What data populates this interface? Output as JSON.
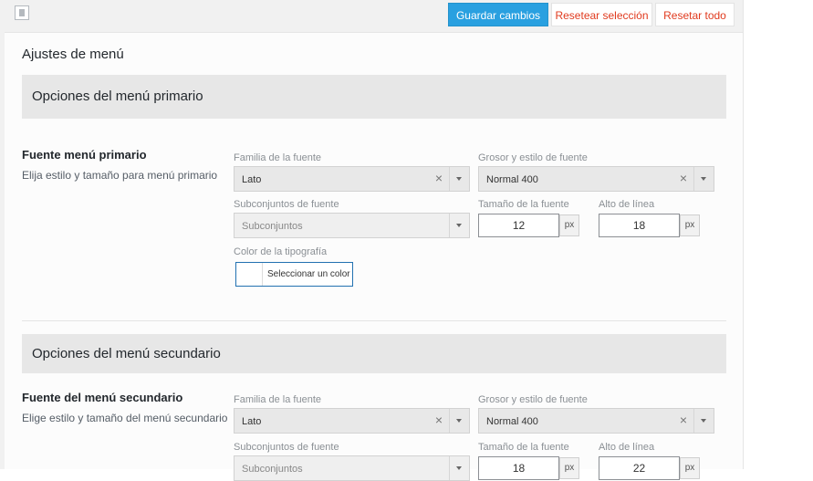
{
  "toolbar": {
    "save_label": "Guardar cambios",
    "reset_selection_label": "Resetear selección",
    "reset_all_label": "Resetar todo"
  },
  "page": {
    "title": "Ajustes de menú"
  },
  "primary": {
    "section_title": "Opciones del menú primario",
    "option_title": "Fuente menú primario",
    "option_desc": "Elija estilo y tamaño para menú primario",
    "font_family": {
      "label": "Familia de la fuente",
      "value": "Lato"
    },
    "font_weight": {
      "label": "Grosor y estilo de fuente",
      "value": "Normal 400"
    },
    "subsets": {
      "label": "Subconjuntos de fuente",
      "placeholder": "Subconjuntos"
    },
    "font_size": {
      "label": "Tamaño de la fuente",
      "value": "12",
      "unit": "px"
    },
    "line_height": {
      "label": "Alto de línea",
      "value": "18",
      "unit": "px"
    },
    "color": {
      "label": "Color de la tipografía",
      "button_label": "Seleccionar un color"
    }
  },
  "secondary": {
    "section_title": "Opciones del menú secundario",
    "option_title": "Fuente del menú secundario",
    "option_desc": "Elige estilo y tamaño del menú secundario",
    "font_family": {
      "label": "Familia de la fuente",
      "value": "Lato"
    },
    "font_weight": {
      "label": "Grosor y estilo de fuente",
      "value": "Normal 400"
    },
    "subsets": {
      "label": "Subconjuntos de fuente",
      "placeholder": "Subconjuntos"
    },
    "font_size": {
      "label": "Tamaño de la fuente",
      "value": "18",
      "unit": "px"
    },
    "line_height": {
      "label": "Alto de línea",
      "value": "22",
      "unit": "px"
    }
  },
  "colors": {
    "accent": "#29a0e0",
    "danger": "#e03a1e",
    "section_bg": "#e7e7e7"
  }
}
